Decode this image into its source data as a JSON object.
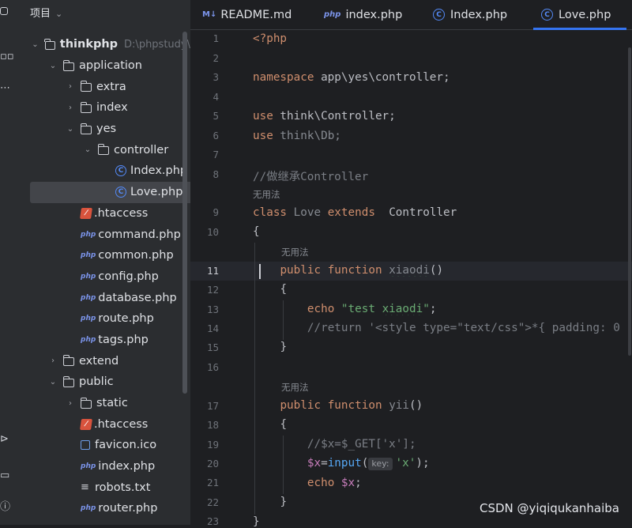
{
  "project_panel": {
    "title": "项目",
    "tree": [
      {
        "label": "thinkphp",
        "path": "D:\\phpstudy\\",
        "type": "folder",
        "depth": 0,
        "expanded": true
      },
      {
        "label": "application",
        "type": "folder",
        "depth": 1,
        "expanded": true
      },
      {
        "label": "extra",
        "type": "folder",
        "depth": 2,
        "expanded": false
      },
      {
        "label": "index",
        "type": "folder",
        "depth": 2,
        "expanded": false
      },
      {
        "label": "yes",
        "type": "folder",
        "depth": 2,
        "expanded": true
      },
      {
        "label": "controller",
        "type": "folder",
        "depth": 3,
        "expanded": true
      },
      {
        "label": "Index.php",
        "type": "class",
        "depth": 4
      },
      {
        "label": "Love.php",
        "type": "class",
        "depth": 4,
        "selected": true
      },
      {
        "label": ".htaccess",
        "type": "htaccess",
        "depth": 2
      },
      {
        "label": "command.php",
        "type": "php",
        "depth": 2
      },
      {
        "label": "common.php",
        "type": "php",
        "depth": 2
      },
      {
        "label": "config.php",
        "type": "php",
        "depth": 2
      },
      {
        "label": "database.php",
        "type": "php",
        "depth": 2
      },
      {
        "label": "route.php",
        "type": "php",
        "depth": 2
      },
      {
        "label": "tags.php",
        "type": "php",
        "depth": 2
      },
      {
        "label": "extend",
        "type": "folder",
        "depth": 1,
        "expanded": false
      },
      {
        "label": "public",
        "type": "folder",
        "depth": 1,
        "expanded": true
      },
      {
        "label": "static",
        "type": "folder",
        "depth": 2,
        "expanded": false
      },
      {
        "label": ".htaccess",
        "type": "htaccess",
        "depth": 2
      },
      {
        "label": "favicon.ico",
        "type": "ico",
        "depth": 2
      },
      {
        "label": "index.php",
        "type": "php",
        "depth": 2
      },
      {
        "label": "robots.txt",
        "type": "txt",
        "depth": 2
      },
      {
        "label": "router.php",
        "type": "php",
        "depth": 2
      }
    ]
  },
  "tabs": [
    {
      "label": "README.md",
      "icon": "markdown-icon",
      "active": false
    },
    {
      "label": "index.php",
      "icon": "php-icon",
      "active": false
    },
    {
      "label": "Index.php",
      "icon": "class-icon",
      "active": false
    },
    {
      "label": "Love.php",
      "icon": "class-icon",
      "active": true
    }
  ],
  "editor": {
    "current_line": 11,
    "line_numbers": [
      "1",
      "2",
      "3",
      "4",
      "5",
      "6",
      "7",
      "8",
      "9",
      "10",
      "11",
      "12",
      "13",
      "14",
      "15",
      "16",
      "17",
      "18",
      "19",
      "20",
      "21",
      "22",
      "23"
    ],
    "code": {
      "l1_open": "<?php",
      "l3_kw": "namespace",
      "l3_rest": " app\\yes\\controller;",
      "l5_kw": "use",
      "l5_rest": " think\\Controller;",
      "l6_kw": "use",
      "l6_rest": " think\\Db;",
      "l8_comment": "//做继承Controller",
      "hint_unused": "无用法",
      "l9_class": "class",
      "l9_name": "Love",
      "l9_extends": "extends",
      "l9_parent": "Controller",
      "l10": "{",
      "l11_public": "public",
      "l11_function": "function",
      "l11_name": "xiaodi",
      "l11_parens": "()",
      "l12": "{",
      "l13_echo": "echo",
      "l13_str_a": "\"test ",
      "l13_str_b": "xiaodi",
      "l13_str_c": "\"",
      "l13_semi": ";",
      "l14_comment": "//return '<style type=\"text/css\">*{ padding: 0",
      "l15": "}",
      "l17_public": "public",
      "l17_function": "function",
      "l17_name": "yii",
      "l17_parens": "()",
      "l18": "{",
      "l19_comment": "//$x=$_GET['x'];",
      "l20_var": "$x",
      "l20_eq": "=",
      "l20_fn": "input",
      "l20_open": "(",
      "l20_hint": "key:",
      "l20_arg": "'x'",
      "l20_close": ");",
      "l21_echo": "echo",
      "l21_var": "$x",
      "l21_semi": ";",
      "l22": "}",
      "l23": "}"
    }
  },
  "watermark": "CSDN @yiqiqukanhaiba",
  "colors": {
    "background": "#1e1f22",
    "panel": "#2b2d30",
    "accent": "#3574f0",
    "keyword": "#cf8e6d",
    "string": "#6aab73",
    "comment": "#7a7e85",
    "variable": "#c77dbb",
    "function": "#56a8f5"
  }
}
